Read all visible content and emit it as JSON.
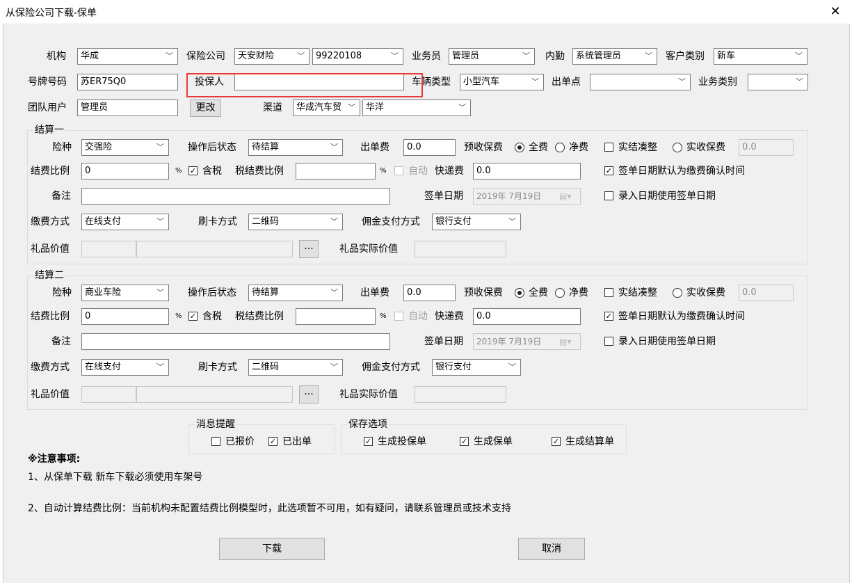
{
  "window": {
    "title": "从保险公司下载-保单",
    "close": "✕"
  },
  "top": {
    "org_label": "机构",
    "org": "华成",
    "insurer_label": "保险公司",
    "insurer": "天安财险",
    "insurer_code": "99220108",
    "salesman_label": "业务员",
    "salesman": "管理员",
    "staff_label": "内勤",
    "staff": "系统管理员",
    "customer_type_label": "客户类别",
    "customer_type": "新车",
    "plate_label": "号牌号码",
    "plate": "苏ER75Q0",
    "applicant_label": "投保人",
    "applicant": "",
    "vehicle_type_label": "车辆类型",
    "vehicle_type": "小型汽车",
    "outlet_label": "出单点",
    "outlet": "",
    "biz_type_label": "业务类别",
    "biz_type": "",
    "team_user_label": "团队用户",
    "team_user": "管理员",
    "change_button": "更改",
    "channel_label": "渠道",
    "channel": "华成汽车贸",
    "channel2": "华洋"
  },
  "settlements": [
    {
      "title": "结算一",
      "kind_label": "险种",
      "kind": "交强险",
      "status_label": "操作后状态",
      "status": "待结算",
      "fee_label": "出单费",
      "fee": "0.0",
      "prepaid_label": "预收保费",
      "full_label": "全费",
      "full_checked": true,
      "net_label": "净费",
      "net_checked": false,
      "roundup_label": "实结凑整",
      "roundup_checked": false,
      "actual_label": "实收保费",
      "actual_checked": false,
      "actual_value": "0.0",
      "ratio_label": "结费比例",
      "ratio": "0",
      "pct": "%",
      "tax_label": "含税",
      "tax_checked": true,
      "tax_ratio_label": "税结费比例",
      "tax_ratio": "",
      "pct2": "%",
      "auto_label": "自动",
      "auto_checked": false,
      "express_label": "快递费",
      "express": "0.0",
      "sign_default_label": "签单日期默认为缴费确认时间",
      "sign_default_checked": true,
      "remark_label": "备注",
      "remark": "",
      "sign_date_label": "签单日期",
      "sign_date": "2019年  7月19日",
      "entry_date_label": "录入日期使用签单日期",
      "entry_date_checked": false,
      "pay_label": "缴费方式",
      "pay": "在线支付",
      "card_label": "刷卡方式",
      "card": "二维码",
      "comm_label": "佣金支付方式",
      "comm": "银行支付",
      "gift_label": "礼品价值",
      "gift1": "",
      "gift2": "",
      "gift_button": "···",
      "gift_actual_label": "礼品实际价值",
      "gift_actual": ""
    },
    {
      "title": "结算二",
      "kind_label": "险种",
      "kind": "商业车险",
      "status_label": "操作后状态",
      "status": "待结算",
      "fee_label": "出单费",
      "fee": "0.0",
      "prepaid_label": "预收保费",
      "full_label": "全费",
      "full_checked": true,
      "net_label": "净费",
      "net_checked": false,
      "roundup_label": "实结凑整",
      "roundup_checked": false,
      "actual_label": "实收保费",
      "actual_checked": false,
      "actual_value": "0.0",
      "ratio_label": "结费比例",
      "ratio": "0",
      "pct": "%",
      "tax_label": "含税",
      "tax_checked": true,
      "tax_ratio_label": "税结费比例",
      "tax_ratio": "",
      "pct2": "%",
      "auto_label": "自动",
      "auto_checked": false,
      "express_label": "快递费",
      "express": "0.0",
      "sign_default_label": "签单日期默认为缴费确认时间",
      "sign_default_checked": true,
      "remark_label": "备注",
      "remark": "",
      "sign_date_label": "签单日期",
      "sign_date": "2019年  7月19日",
      "entry_date_label": "录入日期使用签单日期",
      "entry_date_checked": false,
      "pay_label": "缴费方式",
      "pay": "在线支付",
      "card_label": "刷卡方式",
      "card": "二维码",
      "comm_label": "佣金支付方式",
      "comm": "银行支付",
      "gift_label": "礼品价值",
      "gift1": "",
      "gift2": "",
      "gift_button": "···",
      "gift_actual_label": "礼品实际价值",
      "gift_actual": ""
    }
  ],
  "reminder": {
    "title": "消息提醒",
    "quoted_label": "已报价",
    "quoted_checked": false,
    "issued_label": "已出单",
    "issued_checked": true
  },
  "save_options": {
    "title": "保存选项",
    "proposal_label": "生成投保单",
    "proposal_checked": true,
    "policy_label": "生成保单",
    "policy_checked": true,
    "settle_label": "生成结算单",
    "settle_checked": true
  },
  "notes": {
    "title": "※注意事项:",
    "line1": "1、从保单下载 新车下载必须使用车架号",
    "line2": "2、自动计算结费比例：当前机构未配置结费比例模型时，此选项暂不可用，如有疑问，请联系管理员或技术支持"
  },
  "buttons": {
    "download": "下载",
    "cancel": "取消"
  }
}
